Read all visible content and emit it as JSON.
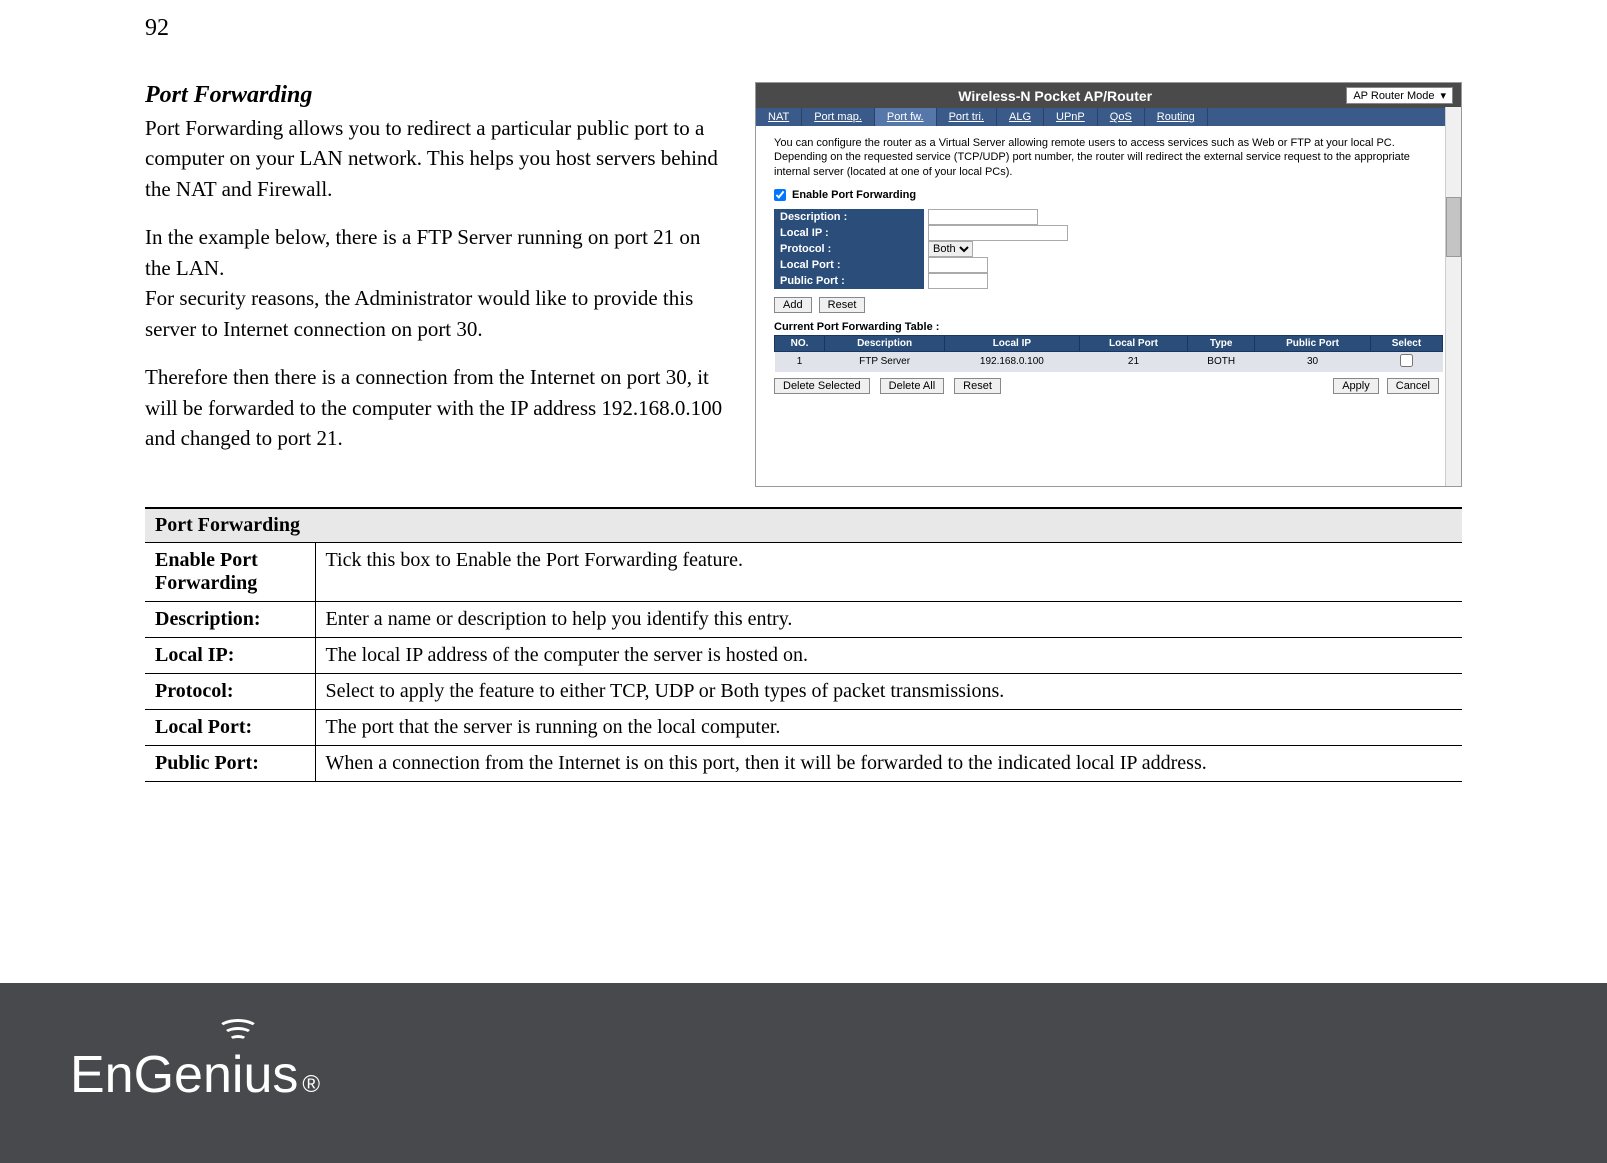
{
  "page_number": "92",
  "section_title": "Port Forwarding",
  "paragraphs": {
    "p1": "Port Forwarding allows you to redirect a particular public port to a computer on your LAN network. This helps you host servers behind the NAT and Firewall.",
    "p2": "In the example below, there is a FTP Server running on port 21 on the LAN.",
    "p3": "For security reasons, the Administrator would like to provide this server to Internet connection on port 30.",
    "p4": "Therefore then there is a connection from the Internet on port 30, it will be forwarded to the computer with the IP address 192.168.0.100 and changed to port 21."
  },
  "screenshot": {
    "header_title": "Wireless-N Pocket AP/Router",
    "mode_select": "AP Router Mode",
    "tabs": [
      "NAT",
      "Port map.",
      "Port fw.",
      "Port tri.",
      "ALG",
      "UPnP",
      "QoS",
      "Routing"
    ],
    "active_tab": 2,
    "body_desc": "You can configure the router as a Virtual Server allowing remote users to access services such as Web or FTP at your local PC. Depending on the requested service (TCP/UDP) port number, the router will redirect the external service request to the appropriate internal server (located at one of your local PCs).",
    "enable_label": "Enable Port Forwarding",
    "enable_checked": true,
    "form": {
      "description_label": "Description :",
      "local_ip_label": "Local IP :",
      "protocol_label": "Protocol :",
      "protocol_value": "Both",
      "local_port_label": "Local Port :",
      "public_port_label": "Public Port :"
    },
    "add_btn": "Add",
    "reset_btn": "Reset",
    "table_title": "Current Port Forwarding Table :",
    "table_headers": [
      "NO.",
      "Description",
      "Local IP",
      "Local Port",
      "Type",
      "Public Port",
      "Select"
    ],
    "table_row": {
      "no": "1",
      "desc": "FTP Server",
      "ip": "192.168.0.100",
      "lport": "21",
      "type": "BOTH",
      "pport": "30"
    },
    "delete_selected": "Delete Selected",
    "delete_all": "Delete All",
    "reset2": "Reset",
    "apply": "Apply",
    "cancel": "Cancel"
  },
  "def_table": {
    "header": "Port Forwarding",
    "rows": [
      {
        "label": "Enable Port Forwarding",
        "desc": "Tick this box to Enable the Port Forwarding feature."
      },
      {
        "label": "Description:",
        "desc": "Enter a name or description to help you identify this entry."
      },
      {
        "label": "Local IP:",
        "desc": "The local IP address of the computer the server is hosted on."
      },
      {
        "label": "Protocol:",
        "desc": "Select to apply the feature to either TCP, UDP or Both types of packet transmissions."
      },
      {
        "label": "Local Port:",
        "desc": "The port that the server is running on the local computer."
      },
      {
        "label": "Public Port:",
        "desc": "When a connection from the Internet is on this port, then it will be forwarded to the indicated local IP address."
      }
    ]
  },
  "logo_text": "EnGenius",
  "logo_reg": "®"
}
